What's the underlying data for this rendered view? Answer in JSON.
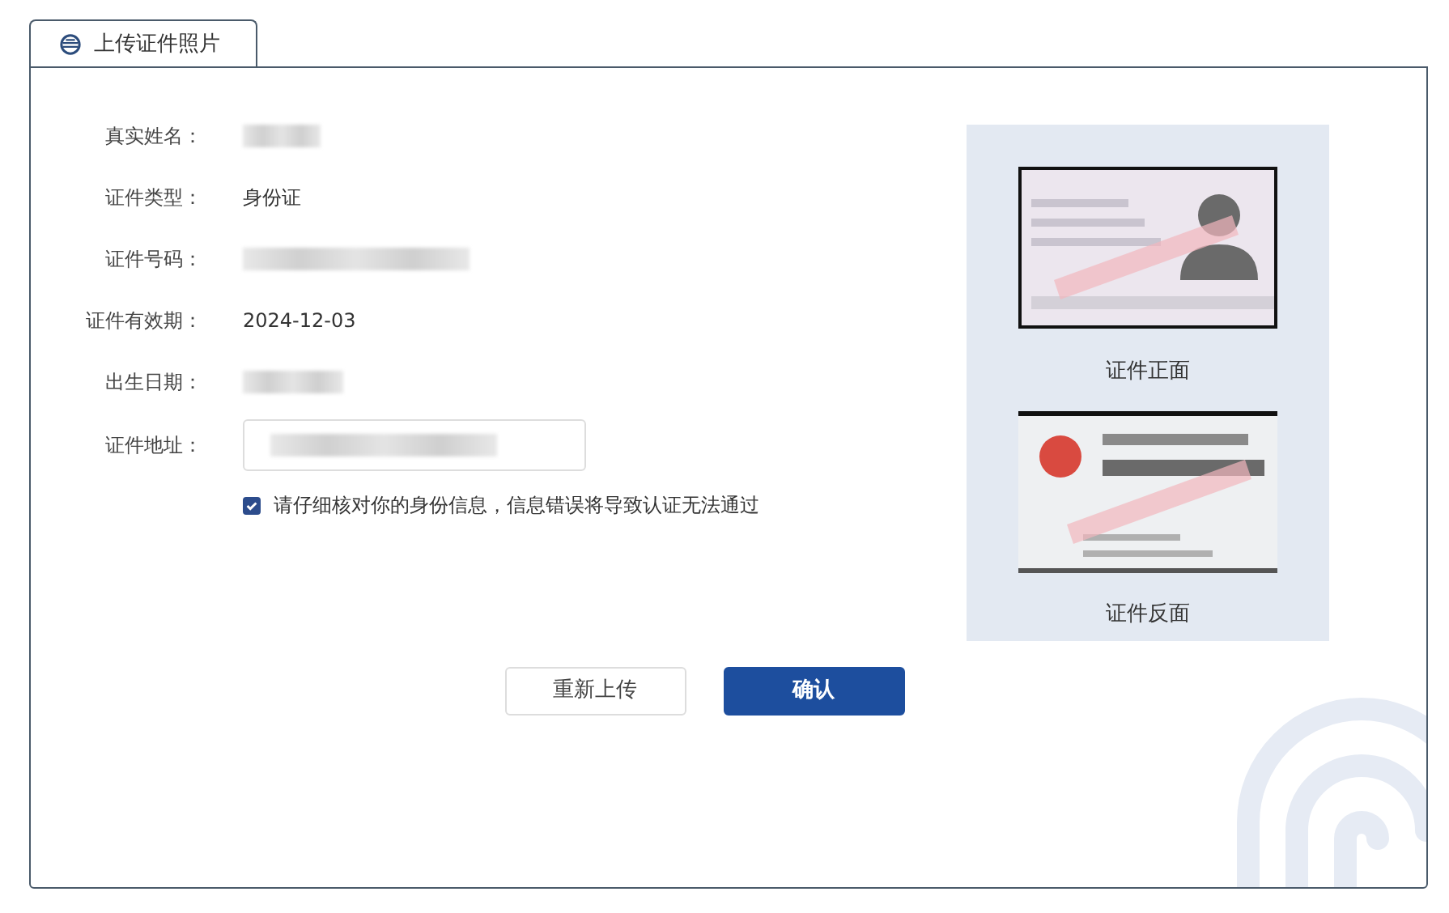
{
  "tab": {
    "label": "上传证件照片",
    "selected": true
  },
  "fields": [
    {
      "label": "真实姓名：",
      "kind": "text",
      "redacted": true
    },
    {
      "label": "证件类型：",
      "kind": "text",
      "value": "身份证"
    },
    {
      "label": "证件号码：",
      "kind": "text",
      "redacted": true
    },
    {
      "label": "证件有效期：",
      "kind": "text",
      "value": "2024-12-03"
    },
    {
      "label": "出生日期：",
      "kind": "text",
      "redacted": true
    },
    {
      "label": "证件地址：",
      "kind": "input",
      "redacted": true
    }
  ],
  "confirm": {
    "label": "请仔细核对你的身份信息，信息错误将导致认证无法通过",
    "checked": true
  },
  "photos": [
    {
      "kind": "front",
      "caption": "证件正面"
    },
    {
      "kind": "back",
      "caption": "证件反面"
    }
  ],
  "buttons": [
    {
      "label": "重新上传",
      "kind": "secondary"
    },
    {
      "label": "确认",
      "kind": "primary"
    }
  ]
}
